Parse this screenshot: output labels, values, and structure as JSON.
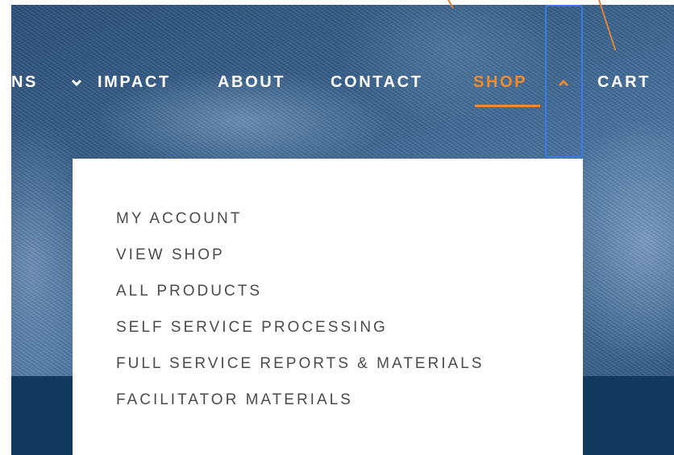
{
  "nav": {
    "items": [
      {
        "label": "NS",
        "has_chevron": true
      },
      {
        "label": "IMPACT"
      },
      {
        "label": "ABOUT"
      },
      {
        "label": "CONTACT"
      },
      {
        "label": "SHOP",
        "active": true,
        "has_chevron": true,
        "chevron": "up"
      },
      {
        "label": "CART"
      }
    ],
    "chevron_down_glyph": "⌄",
    "chevron_up_glyph": "^"
  },
  "shop_menu": {
    "items": [
      "MY ACCOUNT",
      "VIEW SHOP",
      "ALL PRODUCTS",
      "SELF SERVICE PROCESSING",
      "FULL SERVICE REPORTS & MATERIALS",
      "FACILITATOR MATERIALS"
    ]
  },
  "colors": {
    "accent": "#f08a2c",
    "focus_ring": "#3c7be0",
    "menu_text": "#4b4b4b",
    "nav_text": "#ffffff"
  }
}
